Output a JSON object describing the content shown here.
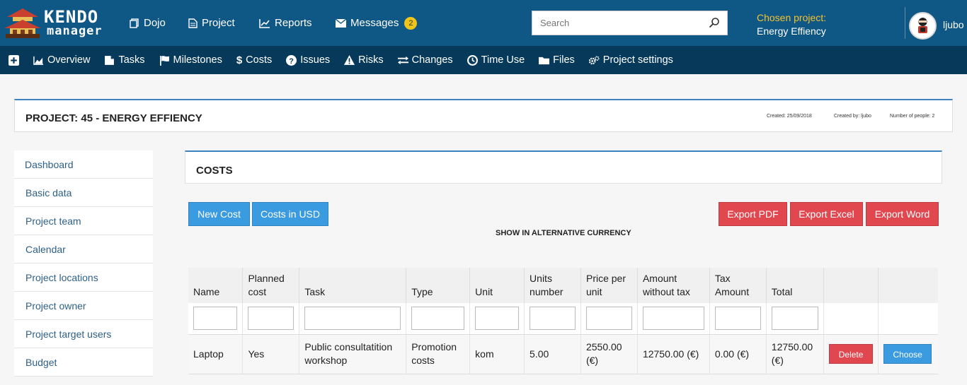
{
  "brand": {
    "line1": "KENDO",
    "line2": "manager"
  },
  "top_nav": [
    {
      "label": "Dojo",
      "icon": "copy-icon"
    },
    {
      "label": "Project",
      "icon": "document-icon"
    },
    {
      "label": "Reports",
      "icon": "chart-line-icon"
    },
    {
      "label": "Messages",
      "icon": "envelope-icon",
      "badge": "2"
    }
  ],
  "search": {
    "placeholder": "Search",
    "value": ""
  },
  "chosen_project": {
    "label": "Chosen project:",
    "value": "Energy Effiency"
  },
  "user": {
    "name": "ljubo"
  },
  "sub_nav": [
    {
      "label": "",
      "icon": "plus-square-icon"
    },
    {
      "label": "Overview",
      "icon": "chart-area-icon"
    },
    {
      "label": "Tasks",
      "icon": "tasks-icon"
    },
    {
      "label": "Milestones",
      "icon": "flag-icon"
    },
    {
      "label": "Costs",
      "icon": "dollar-icon"
    },
    {
      "label": "Issues",
      "icon": "question-circle-icon"
    },
    {
      "label": "Risks",
      "icon": "warning-icon"
    },
    {
      "label": "Changes",
      "icon": "exchange-icon"
    },
    {
      "label": "Time Use",
      "icon": "clock-icon"
    },
    {
      "label": "Files",
      "icon": "folder-icon"
    },
    {
      "label": "Project settings",
      "icon": "cogs-icon"
    }
  ],
  "project_header": {
    "title": "PROJECT: 45 - ENERGY EFFIENCY",
    "created": "Created: 25/09/2018",
    "created_by": "Created by: ljubo",
    "people": "Number of people: 2"
  },
  "sidebar": {
    "items": [
      "Dashboard",
      "Basic data",
      "Project team",
      "Calendar",
      "Project locations",
      "Project owner",
      "Project target users",
      "Budget"
    ]
  },
  "costs": {
    "title": "COSTS",
    "new_cost": "New Cost",
    "costs_usd": "Costs in USD",
    "export_pdf": "Export PDF",
    "export_excel": "Export Excel",
    "export_word": "Export Word",
    "alt_currency": "SHOW IN ALTERNATIVE CURRENCY"
  },
  "table": {
    "columns": [
      "Name",
      "Planned cost",
      "Task",
      "Type",
      "Unit",
      "Units number",
      "Price per unit",
      "Amount without tax",
      "Tax Amount",
      "Total",
      "",
      ""
    ],
    "rows": [
      {
        "name": "Laptop",
        "planned": "Yes",
        "task": "Public consultatition workshop",
        "type": "Promotion costs",
        "unit": "kom",
        "units_number": "5.00",
        "price_per_unit": "2550.00 (€)",
        "amount_wo_tax": "12750.00 (€)",
        "tax_amount": "0.00 (€)",
        "total": "12750.00 (€)",
        "delete_label": "Delete",
        "choose_label": "Choose"
      }
    ]
  },
  "colors": {
    "topbar": "#0f5785",
    "subnav": "#073a5a",
    "accent_yellow": "#f2c230",
    "button_blue": "#3a9be0",
    "button_red": "#e1474f",
    "link": "#2e5f86"
  }
}
